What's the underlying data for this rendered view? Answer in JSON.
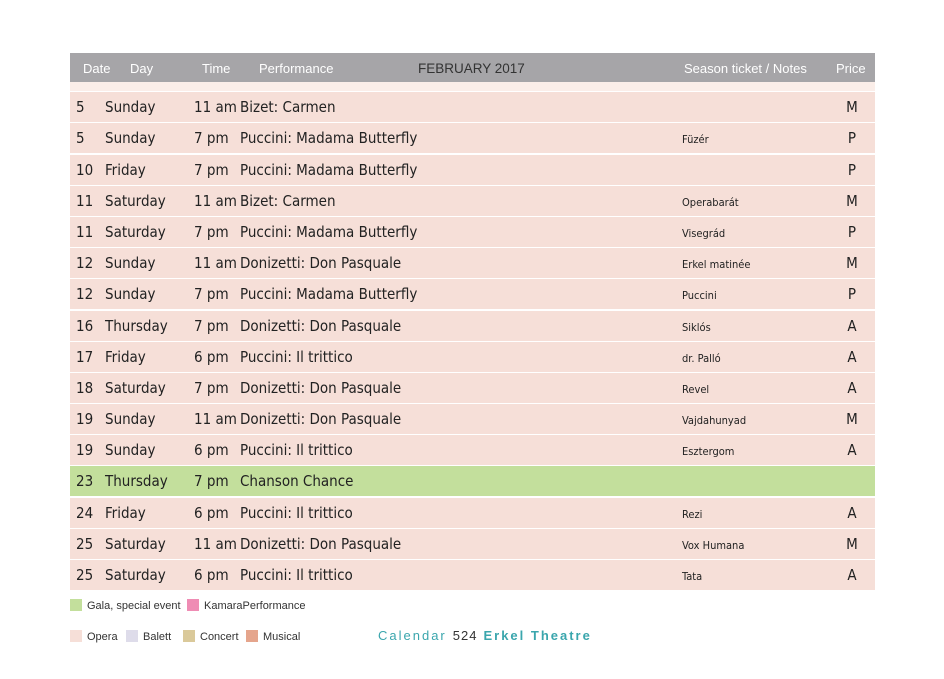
{
  "header": {
    "date": "Date",
    "day": "Day",
    "time": "Time",
    "performance": "Performance",
    "month": "FEBRUARY 2017",
    "notes": "Season ticket / Notes",
    "price": "Price"
  },
  "rows": [
    {
      "date": "5",
      "day": "Sunday",
      "time": "11 am",
      "performance": "Bizet: Carmen",
      "notes": "",
      "price": "M",
      "category": "opera"
    },
    {
      "date": "5",
      "day": "Sunday",
      "time": "7 pm",
      "performance": "Puccini: Madama Butterfly",
      "notes": "Füzér",
      "price": "P",
      "category": "opera"
    },
    {
      "date": "10",
      "day": "Friday",
      "time": "7 pm",
      "performance": "Puccini: Madama Butterfly",
      "notes": "",
      "price": "P",
      "category": "opera"
    },
    {
      "date": "11",
      "day": "Saturday",
      "time": "11 am",
      "performance": "Bizet: Carmen",
      "notes": "Operabarát",
      "price": "M",
      "category": "opera"
    },
    {
      "date": "11",
      "day": "Saturday",
      "time": "7 pm",
      "performance": "Puccini: Madama Butterfly",
      "notes": "Visegrád",
      "price": "P",
      "category": "opera"
    },
    {
      "date": "12",
      "day": "Sunday",
      "time": "11 am",
      "performance": "Donizetti: Don Pasquale",
      "notes": "Erkel matinée",
      "price": "M",
      "category": "opera"
    },
    {
      "date": "12",
      "day": "Sunday",
      "time": "7 pm",
      "performance": "Puccini: Madama Butterfly",
      "notes": "Puccini",
      "price": "P",
      "category": "opera"
    },
    {
      "date": "16",
      "day": "Thursday",
      "time": "7 pm",
      "performance": "Donizetti: Don Pasquale",
      "notes": "Siklós",
      "price": "A",
      "category": "opera"
    },
    {
      "date": "17",
      "day": "Friday",
      "time": "6 pm",
      "performance": "Puccini: Il trittico",
      "notes": "dr. Palló",
      "price": "A",
      "category": "opera"
    },
    {
      "date": "18",
      "day": "Saturday",
      "time": "7 pm",
      "performance": "Donizetti: Don Pasquale",
      "notes": "Revel",
      "price": "A",
      "category": "opera"
    },
    {
      "date": "19",
      "day": "Sunday",
      "time": "11 am",
      "performance": "Donizetti: Don Pasquale",
      "notes": "Vajdahunyad",
      "price": "M",
      "category": "opera"
    },
    {
      "date": "19",
      "day": "Sunday",
      "time": "6 pm",
      "performance": "Puccini: Il trittico",
      "notes": "Esztergom",
      "price": "A",
      "category": "opera"
    },
    {
      "date": "23",
      "day": "Thursday",
      "time": "7 pm",
      "performance": "Chanson Chance",
      "notes": "",
      "price": "",
      "category": "gala"
    },
    {
      "date": "24",
      "day": "Friday",
      "time": "6 pm",
      "performance": "Puccini: Il trittico",
      "notes": "Rezi",
      "price": "A",
      "category": "opera"
    },
    {
      "date": "25",
      "day": "Saturday",
      "time": "11 am",
      "performance": "Donizetti: Don Pasquale",
      "notes": "Vox Humana",
      "price": "M",
      "category": "opera"
    },
    {
      "date": "25",
      "day": "Saturday",
      "time": "6 pm",
      "performance": "Puccini: Il trittico",
      "notes": "Tata",
      "price": "A",
      "category": "opera"
    }
  ],
  "legend": {
    "gala": "Gala, special event",
    "kamara": "KamaraPerformance",
    "opera": "Opera",
    "balett": "Balett",
    "concert": "Concert",
    "musical": "Musical"
  },
  "colors": {
    "opera": "#f6dfd8",
    "gala": "#c3df9c",
    "kamara": "#ef8cb4",
    "balett": "#dedcea",
    "concert": "#dac99a",
    "musical": "#e5a58c",
    "header": "#a6a5a8",
    "accent": "#3aa6ad"
  },
  "footer": {
    "section": "Calendar",
    "page": "524",
    "theatre": "Erkel Theatre"
  }
}
